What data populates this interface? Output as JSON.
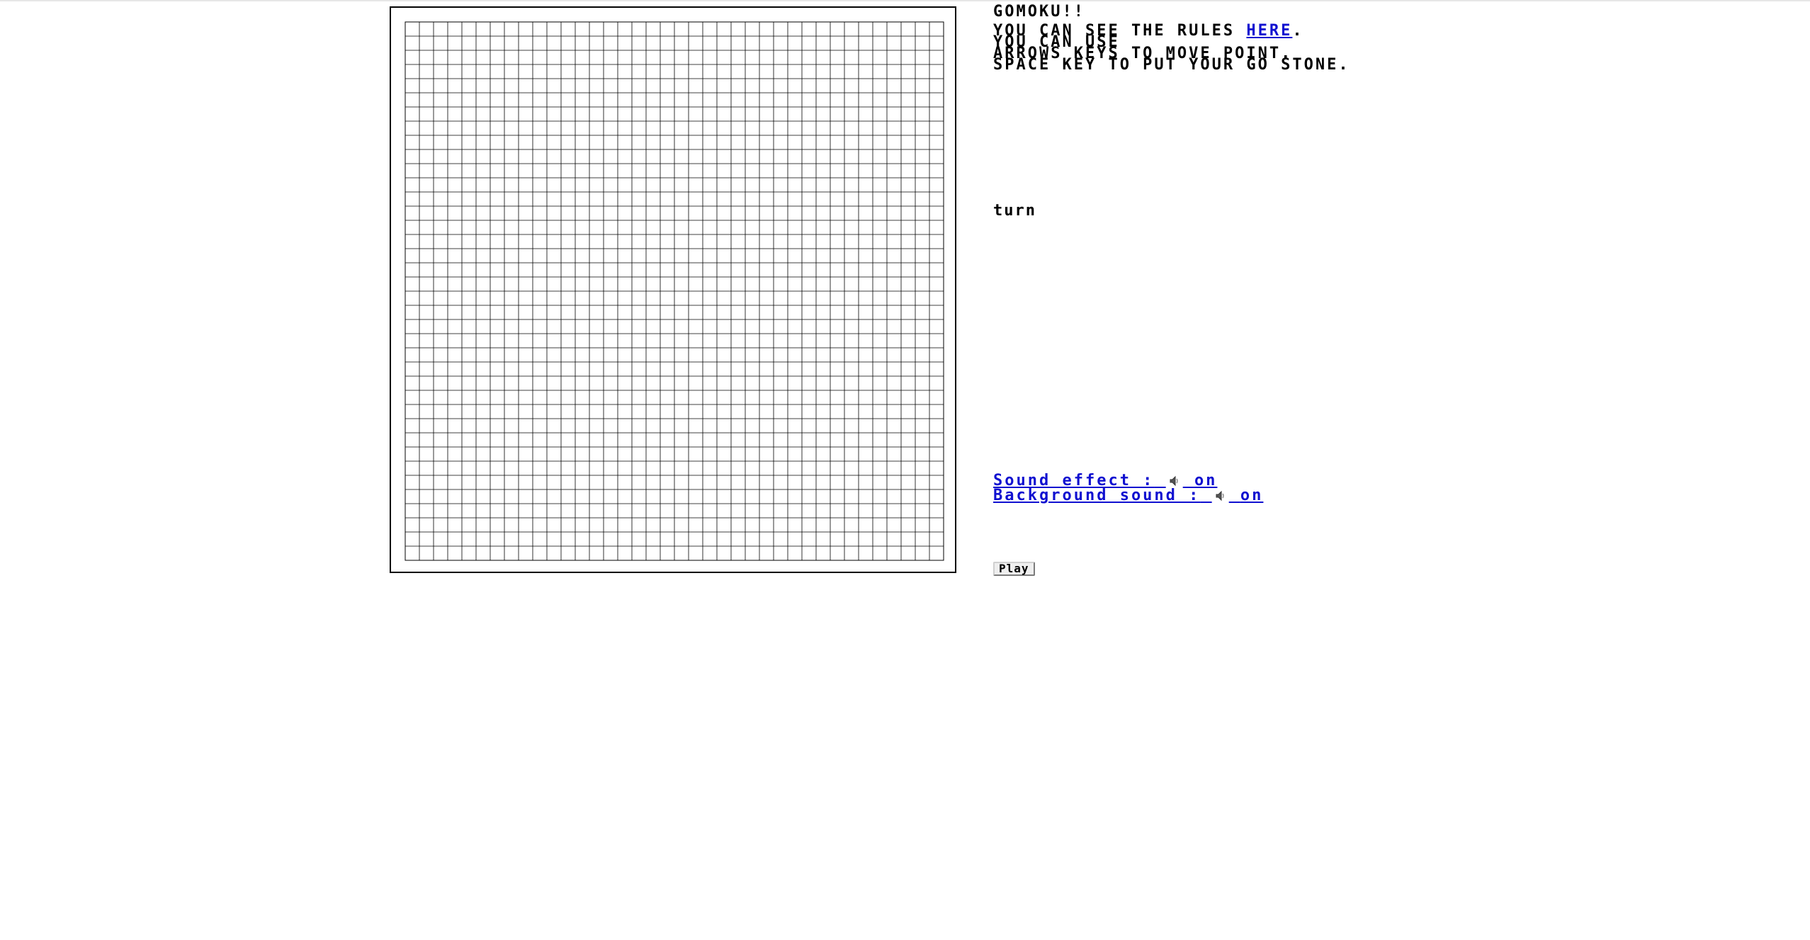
{
  "game": {
    "title": "GOMOKU!!",
    "rules_prefix": "YOU CAN SEE THE RULES ",
    "rules_link": "HERE",
    "rules_suffix": ".",
    "instruction_line1": "YOU CAN USE",
    "instruction_line2": "ARROWS KEYS TO MOVE POINT.",
    "instruction_line3": "SPACE KEY TO PUT YOUR GO STONE.",
    "turn_label": "turn"
  },
  "board": {
    "size": 38,
    "grid_color": "#000000"
  },
  "sound": {
    "effect_label": "Sound effect :",
    "effect_state": "on",
    "background_label": "Background sound :",
    "background_state": "on",
    "speaker_icon": "speaker-icon",
    "link_color": "#1010d0"
  },
  "controls": {
    "play_label": "Play"
  }
}
